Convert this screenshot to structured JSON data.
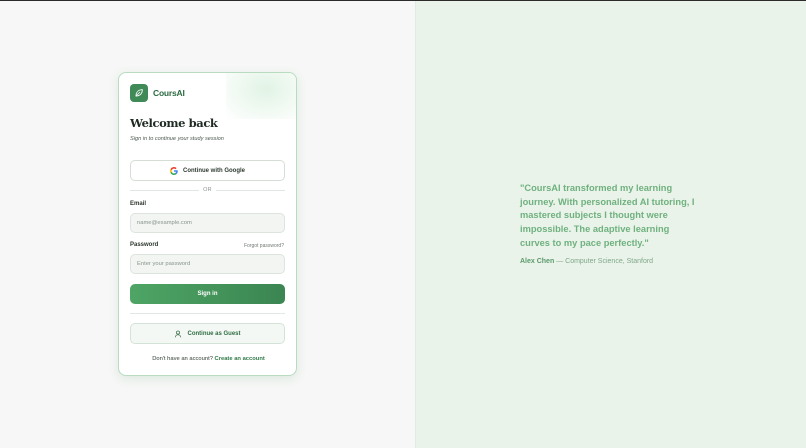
{
  "brand": {
    "name": "CoursAI"
  },
  "login": {
    "title": "Welcome back",
    "subtitle": "Sign in to continue your study session",
    "google_label": "Continue with Google",
    "divider_text": "OR",
    "email_label": "Email",
    "email_placeholder": "name@example.com",
    "password_label": "Password",
    "forgot_label": "Forgot password?",
    "password_placeholder": "Enter your password",
    "signin_label": "Sign in",
    "guest_label": "Continue as Guest",
    "signup_prompt": "Don't have an account?",
    "signup_link": "Create an account"
  },
  "testimonial": {
    "quote": "\"CoursAI transformed my learning journey. With personalized AI tutoring, I mastered subjects I thought were impossible. The adaptive learning curves to my pace perfectly.\"",
    "author_name": "Alex Chen",
    "author_role": "— Computer Science, Stanford"
  },
  "colors": {
    "accent": "#3f8a57",
    "accent_light": "#6fb17f",
    "panel_bg": "#eaf3ea"
  },
  "icons": {
    "logo": "leaf-icon",
    "google": "google-icon",
    "guest": "user-icon"
  }
}
